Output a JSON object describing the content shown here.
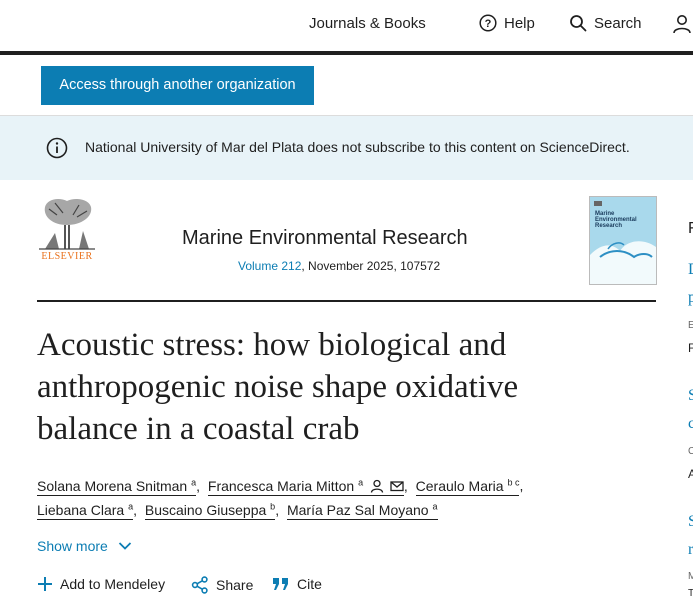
{
  "nav": {
    "journals_books": "Journals & Books",
    "help": "Help",
    "search": "Search"
  },
  "access_button": "Access through another organization",
  "banner": {
    "message": "National University of Mar del Plata does not subscribe to this content on ScienceDirect."
  },
  "journal": {
    "publisher": "ELSEVIER",
    "title": "Marine Environmental Research",
    "volume_link": "Volume 212",
    "issue_rest": ", November 2025, 107572",
    "cover_title": "Marine Environmental Research"
  },
  "article": {
    "title_lines": [
      "Acoustic stress: how biological and",
      "anthropogenic noise shape oxidative",
      "balance in a coastal crab"
    ]
  },
  "authors": [
    {
      "name": "Solana Morena Snitman",
      "sup": "a"
    },
    {
      "name": "Francesca Maria Mitton",
      "sup": "a"
    },
    {
      "name": "Ceraulo Maria",
      "sup": "b c"
    },
    {
      "name": "Liebana Clara",
      "sup": "a"
    },
    {
      "name": "Buscaino Giuseppa",
      "sup": "b"
    },
    {
      "name": "María Paz Sal Moyano",
      "sup": "a"
    }
  ],
  "show_more": "Show more",
  "actions": {
    "mendeley": "Add to Mendeley",
    "share": "Share",
    "cite": "Cite"
  },
  "sidebar_fragments": [
    "F",
    "D",
    "p",
    "E",
    "F",
    "S",
    "c",
    "C",
    "A",
    "S",
    "r",
    "M",
    "T"
  ],
  "colors": {
    "accent": "#0c7db3",
    "banner_bg": "#e8f3f8",
    "elsevier_orange": "#e9711c",
    "text": "#1f1f1f"
  }
}
